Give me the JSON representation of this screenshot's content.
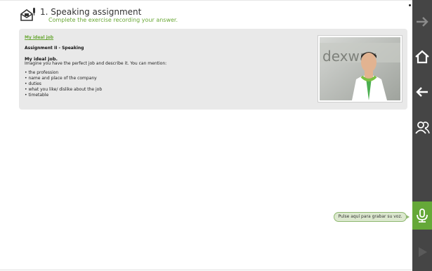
{
  "header": {
    "title": "1. Speaking assignment",
    "subtitle": "Complete the exercise recording your answer."
  },
  "card": {
    "link": "My ideal job",
    "assignment": "Assignment II - Speaking",
    "heading": "My ideal job.",
    "intro": "Imagine you have the perfect job and describe it. You can mention:",
    "items": [
      "the profession",
      "name and place of the company",
      "duties",
      "what you like/ dislike about the job",
      "timetable"
    ],
    "photo_logo": "dexway"
  },
  "record_hint": "Pulse aquí para grabar su voz.",
  "icons": {
    "header": "speaking-assignment-icon",
    "sidebar": [
      "next-arrow-icon",
      "home-icon",
      "back-arrow-icon",
      "users-icon",
      "microphone-icon",
      "play-icon"
    ]
  },
  "colors": {
    "accent_green": "#65a838",
    "sidebar_bg": "#454545",
    "card_bg": "#e9e9e9"
  }
}
